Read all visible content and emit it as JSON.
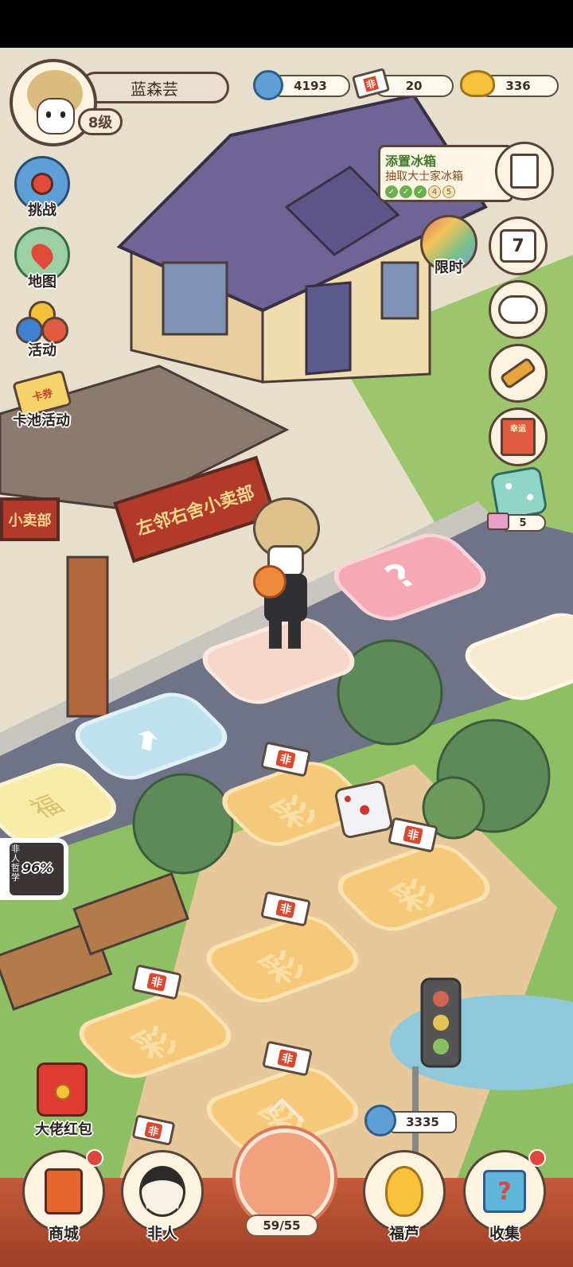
{
  "player": {
    "name": "蓝森芸",
    "level": "8级"
  },
  "currency": [
    {
      "icon": "cloud-coin-icon",
      "value": "4193"
    },
    {
      "icon": "ticket-icon",
      "value": "20",
      "ticket_text": "非"
    },
    {
      "icon": "gold-ingot-icon",
      "value": "336"
    }
  ],
  "left_menu": {
    "challenge": "挑战",
    "map": "地图",
    "activity": "活动",
    "card_pool": "卡池活动",
    "card_ticket_text": "卡券"
  },
  "task": {
    "title": "添置冰箱",
    "subtitle": "抽取大士家冰箱",
    "steps": [
      "✓",
      "✓",
      "✓",
      "4",
      "5"
    ]
  },
  "limited": {
    "label": "限时"
  },
  "right_menu": {
    "calendar_day": "7",
    "lottery_text": "幸运",
    "dice_count": "5"
  },
  "shop": {
    "sign_main": "左邻右舍小卖部",
    "sign_side": "小卖部"
  },
  "board": {
    "question_mark": "?",
    "ticket_text": "非",
    "tile_glyph": "彩",
    "bag_text": "福"
  },
  "progress_avatar": {
    "percent": "96%",
    "tag": "非人哲学"
  },
  "red_packet": {
    "label": "大佬红包"
  },
  "bottom_bar": {
    "shop": "商城",
    "feiren": "非人",
    "dice_progress": "59/55",
    "hulu": "福芦",
    "collect": "收集",
    "hulu_cost": "3335"
  },
  "colors": {
    "road": "#6f7388",
    "grass": "#8fbf63",
    "path": "#e7c89a",
    "tile": "#f6c97a",
    "roof": "#6f6496",
    "accent": "#e05b3d"
  }
}
